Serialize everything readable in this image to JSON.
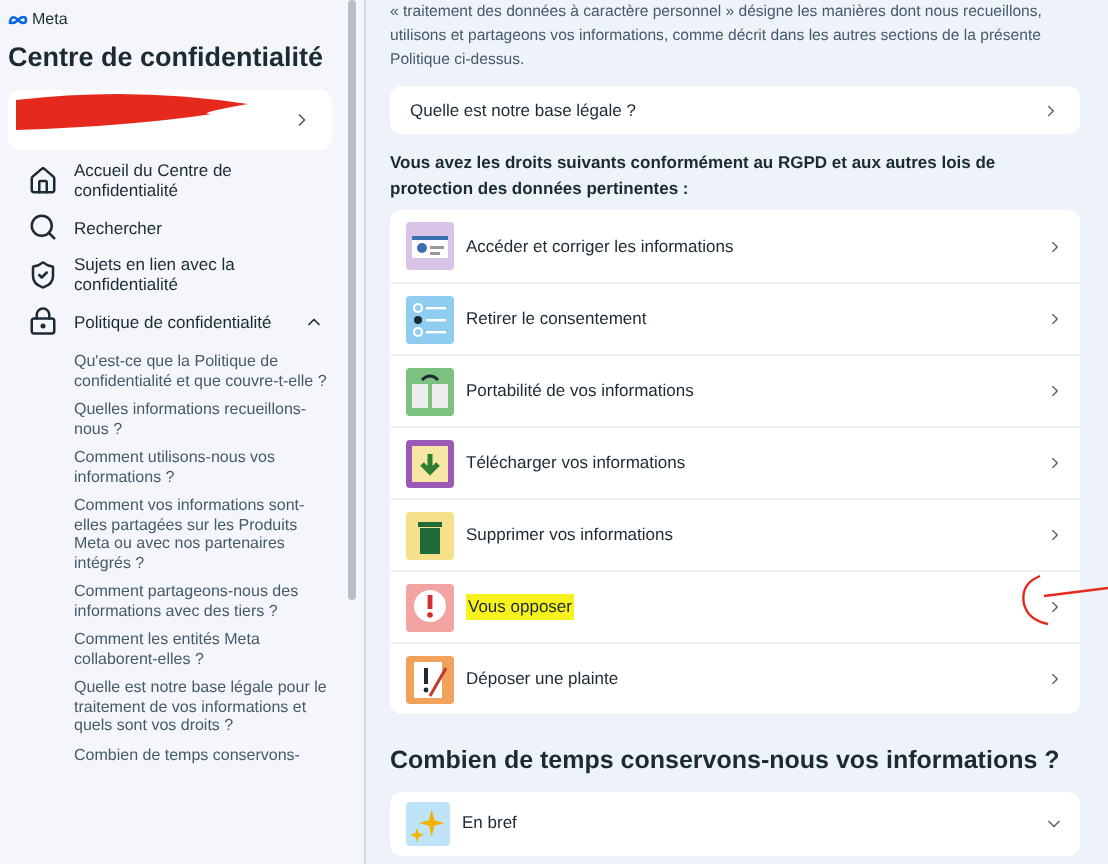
{
  "sidebar": {
    "brand": "Meta",
    "title": "Centre de confidentialité",
    "nav": [
      {
        "label": "Accueil du Centre de confidentialité",
        "kind": "home"
      },
      {
        "label": "Rechercher",
        "kind": "search"
      },
      {
        "label": "Sujets en lien avec la confidentialité",
        "kind": "shield"
      },
      {
        "label": "Politique de confidentialité",
        "kind": "lock",
        "expanded": true,
        "children": [
          {
            "label": "Qu'est-ce que la Politique de confidentialité et que couvre-t-elle ?"
          },
          {
            "label": "Quelles informations recueillons-nous ?"
          },
          {
            "label": "Comment utilisons-nous vos informations ?"
          },
          {
            "label": "Comment vos informations sont-elles partagées sur les Produits Meta ou avec nos partenaires intégrés ?"
          },
          {
            "label": "Comment partageons-nous des informations avec des tiers ?"
          },
          {
            "label": "Comment les entités Meta collaborent-elles ?"
          },
          {
            "label": "Quelle est notre base légale pour le traitement de vos informations et quels sont vos droits ?"
          },
          {
            "label": "Combien de temps conservons-"
          }
        ]
      }
    ]
  },
  "main": {
    "intro": "« traitement des données à caractère personnel » désigne les manières dont nous recueillons, utilisons et partageons vos informations, comme décrit dans les autres sections de la présente Politique ci-dessus.",
    "legal_basis_link": "Quelle est notre base légale ?",
    "rights_heading": "Vous avez les droits suivants conformément au RGPD et aux autres lois de protection des données pertinentes :",
    "rights": [
      {
        "label": "Accéder et corriger les informations",
        "highlighted": false
      },
      {
        "label": "Retirer le consentement",
        "highlighted": false
      },
      {
        "label": "Portabilité de vos informations",
        "highlighted": false
      },
      {
        "label": "Télécharger vos informations",
        "highlighted": false
      },
      {
        "label": "Supprimer vos informations",
        "highlighted": false
      },
      {
        "label": "Vous opposer",
        "highlighted": true
      },
      {
        "label": "Déposer une plainte",
        "highlighted": false
      }
    ],
    "retention_heading": "Combien de temps conservons-nous vos informations ?",
    "summary": {
      "label": "En bref",
      "expanded": false
    }
  }
}
